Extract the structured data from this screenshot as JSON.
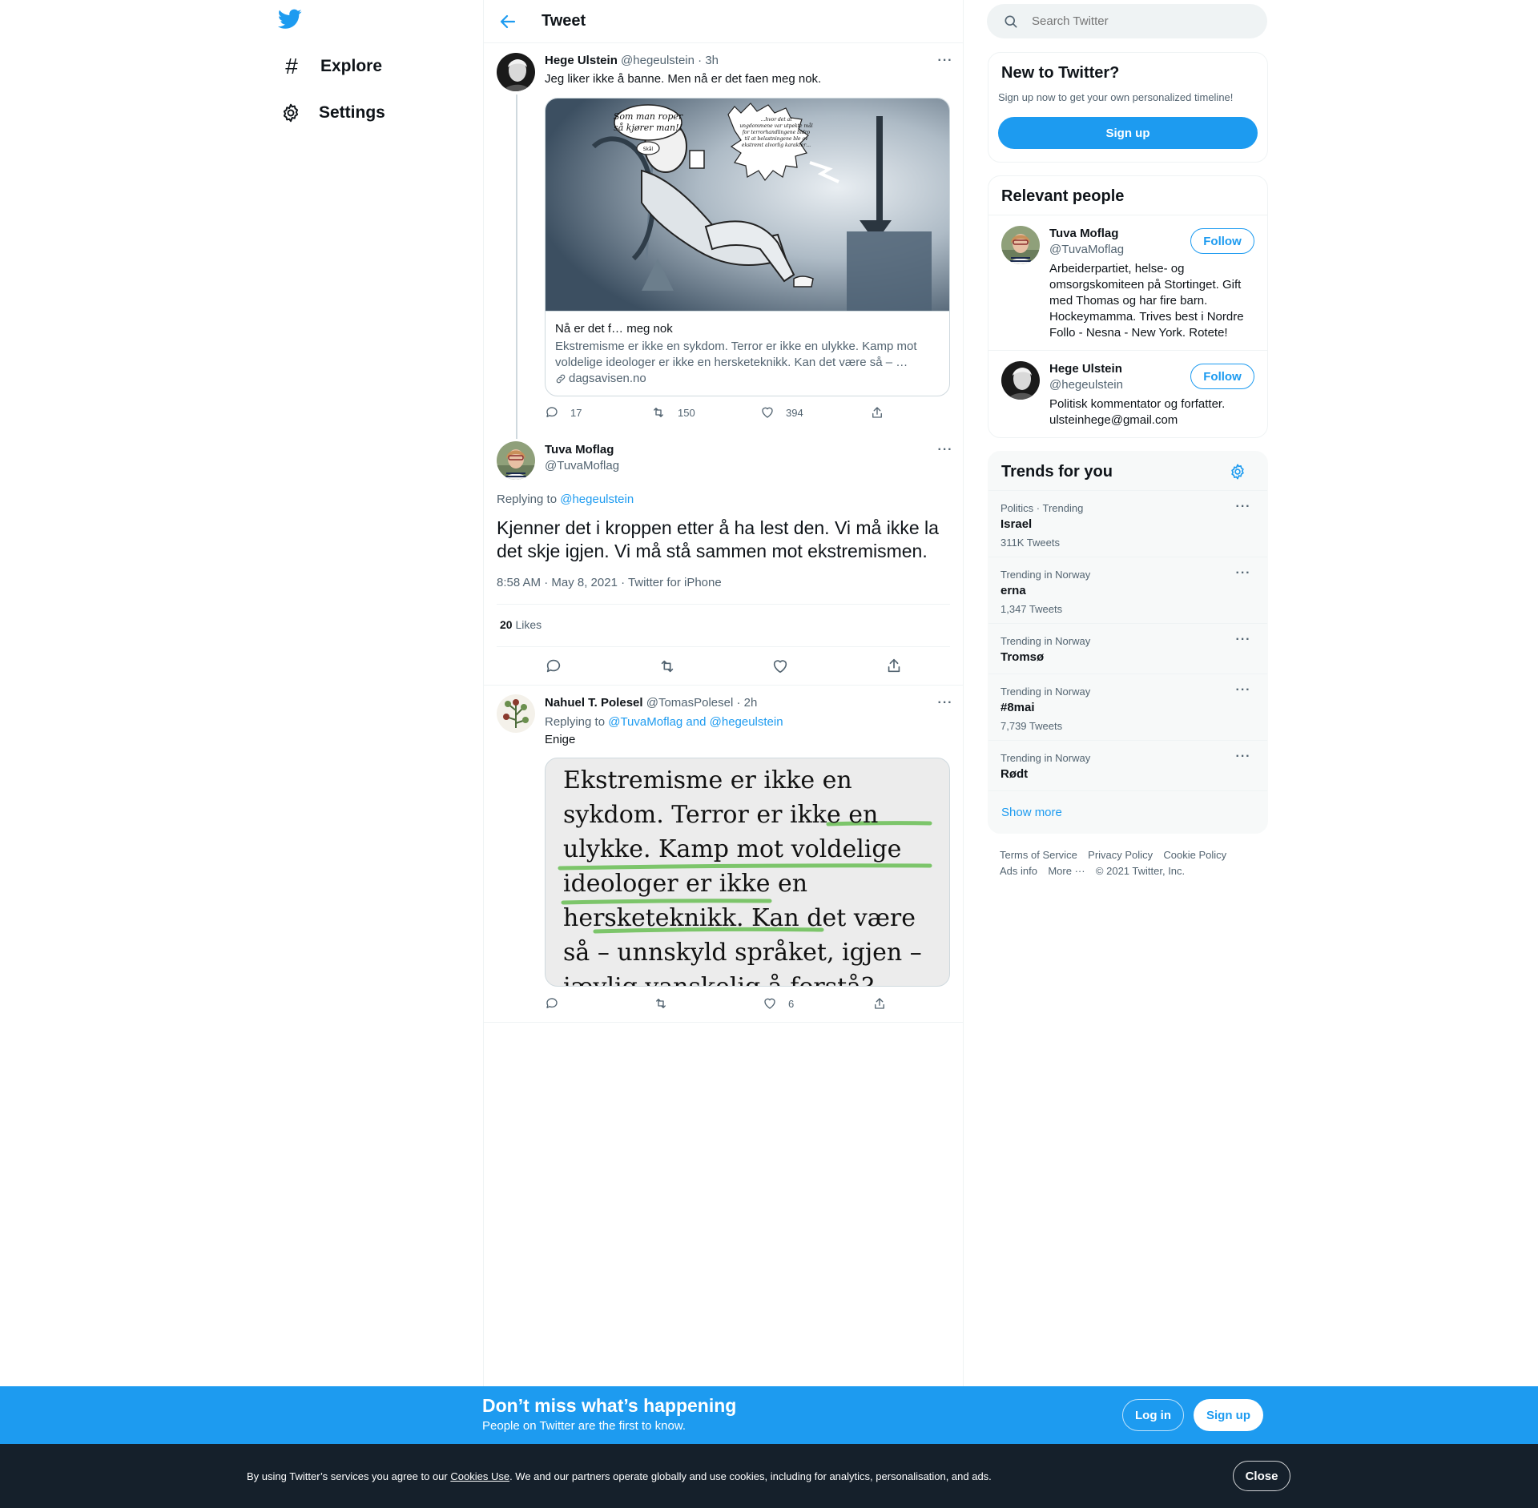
{
  "nav": {
    "explore_label": "Explore",
    "settings_label": "Settings"
  },
  "header": {
    "title": "Tweet"
  },
  "tweet1": {
    "name": "Hege Ulstein",
    "handle": "@hegeulstein",
    "time": "· 3h",
    "text": "Jeg liker ikke å banne. Men nå er det faen meg nok.",
    "card": {
      "title": "Nå er det f… meg nok",
      "description": "Ekstremisme er ikke en sykdom. Terror er ikke en ulykke. Kamp mot voldelige ideologer er ikke en hersketeknikk. Kan det være så – …",
      "domain": "dagsavisen.no",
      "bubble_left": "Som man roper, så kjører man!!",
      "bubble_right": "…hvor det at ungdommene var utpekte mål for terrorhandlingene bidro til at belastningene ble av ekstremt alvorlig karakter…",
      "bubble_small": "Skål"
    },
    "replies": "17",
    "retweets": "150",
    "likes": "394"
  },
  "main_tweet": {
    "name": "Tuva Moflag",
    "handle": "@TuvaMoflag",
    "replying_prefix": "Replying to",
    "replying_to": "@hegeulstein",
    "text": "Kjenner det i kroppen etter å ha lest den. Vi må ikke la det skje igjen. Vi må stå sammen mot ekstremismen.",
    "meta": "8:58 AM · May 8, 2021 · Twitter for iPhone",
    "likes_count": "20",
    "likes_label": "Likes"
  },
  "reply1": {
    "name": "Nahuel T. Polesel",
    "handle": "@TomasPolesel",
    "time": "· 2h",
    "replying_prefix": "Replying to",
    "replying_to": "@TuvaMoflag and @hegeulstein",
    "text": "Enige",
    "image_text": "Ekstremisme er ikke en sykdom. Terror er ikke en ulykke. Kamp mot voldelige ideologer er ikke en hersketeknikk. Kan det være så – unnskyld språket, igjen – jævlig vanskelig å forstå?",
    "likes": "6"
  },
  "search": {
    "placeholder": "Search Twitter"
  },
  "new_to_twitter": {
    "title": "New to Twitter?",
    "subtitle": "Sign up now to get your own personalized timeline!",
    "button": "Sign up"
  },
  "relevant": {
    "title": "Relevant people",
    "people": [
      {
        "name": "Tuva Moflag",
        "handle": "@TuvaMoflag",
        "button": "Follow",
        "bio": "Arbeiderpartiet, helse- og omsorgskomiteen på Stortinget. Gift med Thomas og har fire barn. Hockeymamma. Trives best i Nordre Follo - Nesna - New York. Rotete!"
      },
      {
        "name": "Hege Ulstein",
        "handle": "@hegeulstein",
        "button": "Follow",
        "bio": "Politisk kommentator og forfatter. ulsteinhege@gmail.com"
      }
    ]
  },
  "trends": {
    "title": "Trends for you",
    "items": [
      {
        "context": "Politics · Trending",
        "name": "Israel",
        "count": "311K Tweets"
      },
      {
        "context": "Trending in Norway",
        "name": "erna",
        "count": "1,347 Tweets"
      },
      {
        "context": "Trending in Norway",
        "name": "Tromsø",
        "count": ""
      },
      {
        "context": "Trending in Norway",
        "name": "#8mai",
        "count": "7,739 Tweets"
      },
      {
        "context": "Trending in Norway",
        "name": "Rødt",
        "count": ""
      }
    ],
    "show_more": "Show more"
  },
  "footer": {
    "terms": "Terms of Service",
    "privacy": "Privacy Policy",
    "cookie": "Cookie Policy",
    "ads": "Ads info",
    "more": "More",
    "copyright": "© 2021 Twitter, Inc."
  },
  "signup_bar": {
    "title": "Don’t miss what’s happening",
    "subtitle": "People on Twitter are the first to know.",
    "login": "Log in",
    "signup": "Sign up"
  },
  "cookie_bar": {
    "text_before": "By using Twitter’s services you agree to our",
    "link": "Cookies Use",
    "text_after": ". We and our partners operate globally and use cookies, including for analytics, personalisation, and ads.",
    "close": "Close"
  },
  "colors": {
    "accent": "#1d9bf0",
    "text": "#0f1419",
    "muted": "#536471",
    "highlight": "#7cc56a",
    "cookie_bg": "#15202b"
  }
}
